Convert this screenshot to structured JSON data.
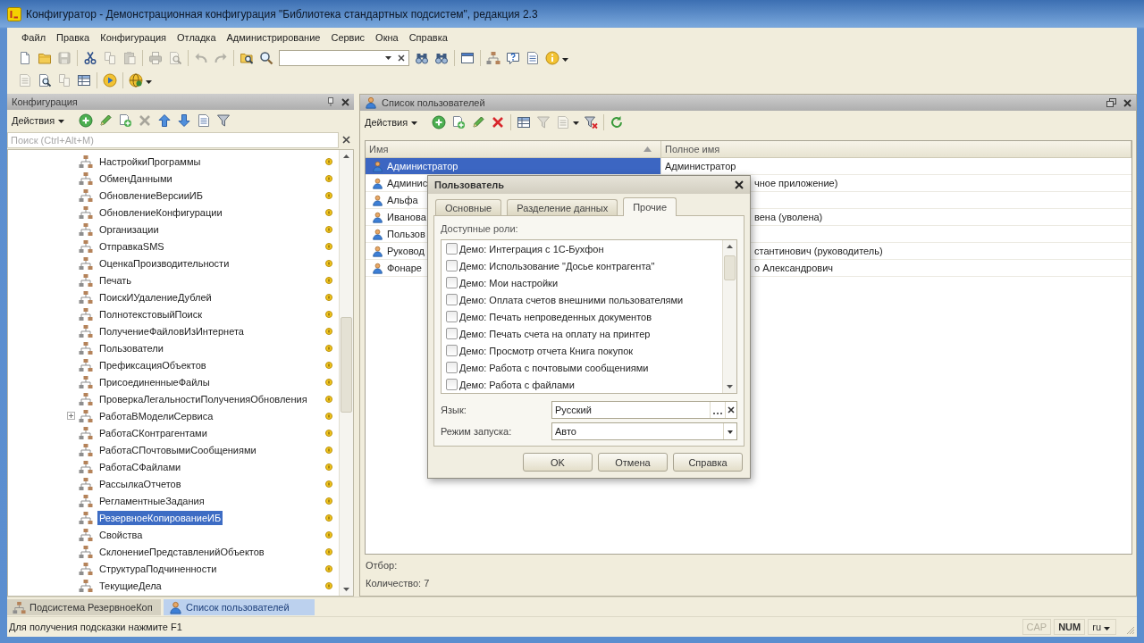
{
  "window": {
    "title": "Конфигуратор - Демонстрационная конфигурация \"Библиотека стандартных подсистем\", редакция 2.3"
  },
  "menu": [
    "Файл",
    "Правка",
    "Конфигурация",
    "Отладка",
    "Администрирование",
    "Сервис",
    "Окна",
    "Справка"
  ],
  "toolbar_main": [
    {
      "kind": "document",
      "disabled": false
    },
    {
      "kind": "folder",
      "disabled": false
    },
    {
      "kind": "floppy",
      "disabled": true
    },
    {
      "kind": "separator"
    },
    {
      "kind": "scissors",
      "disabled": false
    },
    {
      "kind": "copy",
      "disabled": true
    },
    {
      "kind": "paste",
      "disabled": true
    },
    {
      "kind": "separator"
    },
    {
      "kind": "printer",
      "disabled": true
    },
    {
      "kind": "preview",
      "disabled": true
    },
    {
      "kind": "separator"
    },
    {
      "kind": "undo",
      "disabled": true
    },
    {
      "kind": "redo",
      "disabled": true
    },
    {
      "kind": "separator"
    },
    {
      "kind": "foldersearch",
      "disabled": false
    },
    {
      "kind": "search",
      "disabled": false
    },
    {
      "kind": "field"
    },
    {
      "kind": "binoculars",
      "disabled": false
    },
    {
      "kind": "binoculars",
      "disabled": false
    },
    {
      "kind": "separator"
    },
    {
      "kind": "window",
      "disabled": false
    },
    {
      "kind": "separator"
    },
    {
      "kind": "hierarchy",
      "disabled": false
    },
    {
      "kind": "help",
      "disabled": false
    },
    {
      "kind": "sheet",
      "disabled": false
    },
    {
      "kind": "info",
      "disabled": false
    },
    {
      "kind": "caret"
    }
  ],
  "toolbar_debug": [
    {
      "kind": "sheet",
      "disabled": true
    },
    {
      "kind": "preview",
      "disabled": false
    },
    {
      "kind": "copy",
      "disabled": true
    },
    {
      "kind": "table",
      "disabled": false
    },
    {
      "kind": "separator"
    },
    {
      "kind": "play",
      "disabled": false
    },
    {
      "kind": "separator"
    },
    {
      "kind": "globe",
      "disabled": false
    },
    {
      "kind": "caret"
    }
  ],
  "config_panel": {
    "title": "Конфигурация",
    "actions": "Действия",
    "toolbar": [
      {
        "kind": "add",
        "disabled": false
      },
      {
        "kind": "pencil",
        "disabled": false
      },
      {
        "kind": "duplicate",
        "disabled": false
      },
      {
        "kind": "delete",
        "disabled": true
      },
      {
        "kind": "up",
        "disabled": false
      },
      {
        "kind": "down",
        "disabled": false
      },
      {
        "kind": "sheet",
        "disabled": false
      },
      {
        "kind": "filter",
        "disabled": false
      }
    ],
    "search": {
      "placeholder": "Поиск (Ctrl+Alt+M)"
    },
    "tree": [
      {
        "label": "НастройкиПрограммы",
        "expandable": false,
        "selected": false
      },
      {
        "label": "ОбменДанными",
        "expandable": false,
        "selected": false
      },
      {
        "label": "ОбновлениеВерсииИБ",
        "expandable": false,
        "selected": false
      },
      {
        "label": "ОбновлениеКонфигурации",
        "expandable": false,
        "selected": false
      },
      {
        "label": "Организации",
        "expandable": false,
        "selected": false
      },
      {
        "label": "ОтправкаSMS",
        "expandable": false,
        "selected": false
      },
      {
        "label": "ОценкаПроизводительности",
        "expandable": false,
        "selected": false
      },
      {
        "label": "Печать",
        "expandable": false,
        "selected": false
      },
      {
        "label": "ПоискИУдалениеДублей",
        "expandable": false,
        "selected": false
      },
      {
        "label": "ПолнотекстовыйПоиск",
        "expandable": false,
        "selected": false
      },
      {
        "label": "ПолучениеФайловИзИнтернета",
        "expandable": false,
        "selected": false
      },
      {
        "label": "Пользователи",
        "expandable": false,
        "selected": false
      },
      {
        "label": "ПрефиксацияОбъектов",
        "expandable": false,
        "selected": false
      },
      {
        "label": "ПрисоединенныеФайлы",
        "expandable": false,
        "selected": false
      },
      {
        "label": "ПроверкаЛегальностиПолученияОбновления",
        "expandable": false,
        "selected": false
      },
      {
        "label": "РаботаВМоделиСервиса",
        "expandable": true,
        "selected": false
      },
      {
        "label": "РаботаСКонтрагентами",
        "expandable": false,
        "selected": false
      },
      {
        "label": "РаботаСПочтовымиСообщениями",
        "expandable": false,
        "selected": false
      },
      {
        "label": "РаботаСФайлами",
        "expandable": false,
        "selected": false
      },
      {
        "label": "РассылкаОтчетов",
        "expandable": false,
        "selected": false
      },
      {
        "label": "РегламентныеЗадания",
        "expandable": false,
        "selected": false
      },
      {
        "label": "РезервноеКопированиеИБ",
        "expandable": false,
        "selected": true
      },
      {
        "label": "Свойства",
        "expandable": false,
        "selected": false
      },
      {
        "label": "СклонениеПредставленийОбъектов",
        "expandable": false,
        "selected": false
      },
      {
        "label": "СтруктураПодчиненности",
        "expandable": false,
        "selected": false
      },
      {
        "label": "ТекущиеДела",
        "expandable": false,
        "selected": false
      }
    ]
  },
  "users_panel": {
    "title": "Список пользователей",
    "actions": "Действия",
    "toolbar": [
      {
        "kind": "add",
        "disabled": false
      },
      {
        "kind": "duplicate",
        "disabled": false
      },
      {
        "kind": "pencil",
        "disabled": false
      },
      {
        "kind": "delete",
        "disabled": false
      },
      {
        "kind": "separator"
      },
      {
        "kind": "table",
        "disabled": false
      },
      {
        "kind": "filter",
        "disabled": true
      },
      {
        "kind": "sheet",
        "disabled": true
      },
      {
        "kind": "caret"
      },
      {
        "kind": "filteroff",
        "disabled": false
      },
      {
        "kind": "separator"
      },
      {
        "kind": "refresh",
        "disabled": false
      }
    ],
    "table": {
      "columns": [
        {
          "label": "Имя",
          "sorted": true
        },
        {
          "label": "Полное имя",
          "sorted": false
        }
      ],
      "rows": [
        {
          "name": "Администратор",
          "full_name": "Администратор",
          "selected": true
        },
        {
          "name": "Админис",
          "full_name": "чное приложение)",
          "selected": false
        },
        {
          "name": "Альфа",
          "selected": false
        },
        {
          "name": "Иванова",
          "full_name": "вена (уволена)",
          "selected": false
        },
        {
          "name": "Пользов",
          "selected": false
        },
        {
          "name": "Руковод",
          "full_name": "стантинович (руководитель)",
          "selected": false
        },
        {
          "name": "Фонаре",
          "full_name": "о Александрович",
          "selected": false
        }
      ]
    },
    "filter_label": "Отбор:",
    "count": "Количество: 7"
  },
  "dialog": {
    "title": "Пользователь",
    "tabs": [
      {
        "label": "Основные",
        "selected": false
      },
      {
        "label": "Разделение данных",
        "selected": false
      },
      {
        "label": "Прочие",
        "selected": true
      }
    ],
    "roles_label": "Доступные роли:",
    "roles": [
      {
        "label": "Демо: Интеграция с 1С-Бухфон",
        "checked": false
      },
      {
        "label": "Демо: Использование \"Досье контрагента\"",
        "checked": false
      },
      {
        "label": "Демо: Мои настройки",
        "checked": false
      },
      {
        "label": "Демо: Оплата счетов внешними пользователями",
        "checked": false
      },
      {
        "label": "Демо: Печать непроведенных документов",
        "checked": false
      },
      {
        "label": "Демо: Печать счета на оплату на принтер",
        "checked": false
      },
      {
        "label": "Демо: Просмотр отчета Книга покупок",
        "checked": false
      },
      {
        "label": "Демо: Работа с почтовыми сообщениями",
        "checked": false
      },
      {
        "label": "Демо: Работа с файлами",
        "checked": false
      }
    ],
    "language": {
      "label": "Язык:",
      "value": "Русский"
    },
    "launch_mode": {
      "label": "Режим запуска:",
      "value": "Авто"
    },
    "buttons": [
      "OK",
      "Отмена",
      "Справка"
    ]
  },
  "window_tabs": [
    {
      "label": "Подсистема РезервноеКоп",
      "kind": "subsystem",
      "selected": false
    },
    {
      "label": "Список пользователей",
      "kind": "users",
      "selected": true
    }
  ],
  "status_bar": {
    "hint": "Для получения подсказки нажмите F1",
    "indicators": [
      {
        "label": "CAP",
        "on": false
      },
      {
        "label": "NUM",
        "on": true
      }
    ],
    "language": "ru"
  }
}
